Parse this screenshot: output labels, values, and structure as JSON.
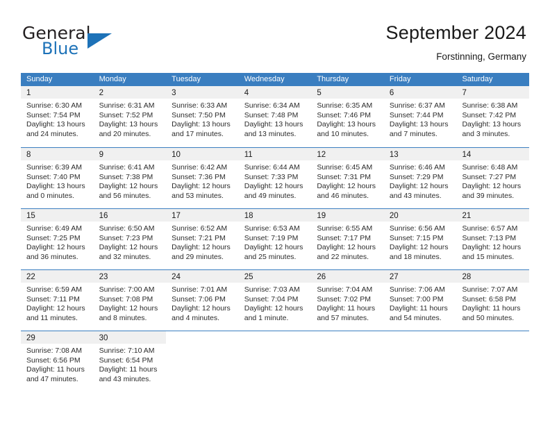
{
  "brand": {
    "name_top": "General",
    "name_bottom": "Blue",
    "accent_color": "#1d72b8"
  },
  "header": {
    "month_title": "September 2024",
    "location": "Forstinning, Germany"
  },
  "calendar": {
    "header_bg": "#3a7ec0",
    "day_strip_bg": "#f0f0f0",
    "weekdays": [
      "Sunday",
      "Monday",
      "Tuesday",
      "Wednesday",
      "Thursday",
      "Friday",
      "Saturday"
    ],
    "weeks": [
      [
        {
          "day": "1",
          "sunrise": "Sunrise: 6:30 AM",
          "sunset": "Sunset: 7:54 PM",
          "daylight1": "Daylight: 13 hours",
          "daylight2": "and 24 minutes."
        },
        {
          "day": "2",
          "sunrise": "Sunrise: 6:31 AM",
          "sunset": "Sunset: 7:52 PM",
          "daylight1": "Daylight: 13 hours",
          "daylight2": "and 20 minutes."
        },
        {
          "day": "3",
          "sunrise": "Sunrise: 6:33 AM",
          "sunset": "Sunset: 7:50 PM",
          "daylight1": "Daylight: 13 hours",
          "daylight2": "and 17 minutes."
        },
        {
          "day": "4",
          "sunrise": "Sunrise: 6:34 AM",
          "sunset": "Sunset: 7:48 PM",
          "daylight1": "Daylight: 13 hours",
          "daylight2": "and 13 minutes."
        },
        {
          "day": "5",
          "sunrise": "Sunrise: 6:35 AM",
          "sunset": "Sunset: 7:46 PM",
          "daylight1": "Daylight: 13 hours",
          "daylight2": "and 10 minutes."
        },
        {
          "day": "6",
          "sunrise": "Sunrise: 6:37 AM",
          "sunset": "Sunset: 7:44 PM",
          "daylight1": "Daylight: 13 hours",
          "daylight2": "and 7 minutes."
        },
        {
          "day": "7",
          "sunrise": "Sunrise: 6:38 AM",
          "sunset": "Sunset: 7:42 PM",
          "daylight1": "Daylight: 13 hours",
          "daylight2": "and 3 minutes."
        }
      ],
      [
        {
          "day": "8",
          "sunrise": "Sunrise: 6:39 AM",
          "sunset": "Sunset: 7:40 PM",
          "daylight1": "Daylight: 13 hours",
          "daylight2": "and 0 minutes."
        },
        {
          "day": "9",
          "sunrise": "Sunrise: 6:41 AM",
          "sunset": "Sunset: 7:38 PM",
          "daylight1": "Daylight: 12 hours",
          "daylight2": "and 56 minutes."
        },
        {
          "day": "10",
          "sunrise": "Sunrise: 6:42 AM",
          "sunset": "Sunset: 7:36 PM",
          "daylight1": "Daylight: 12 hours",
          "daylight2": "and 53 minutes."
        },
        {
          "day": "11",
          "sunrise": "Sunrise: 6:44 AM",
          "sunset": "Sunset: 7:33 PM",
          "daylight1": "Daylight: 12 hours",
          "daylight2": "and 49 minutes."
        },
        {
          "day": "12",
          "sunrise": "Sunrise: 6:45 AM",
          "sunset": "Sunset: 7:31 PM",
          "daylight1": "Daylight: 12 hours",
          "daylight2": "and 46 minutes."
        },
        {
          "day": "13",
          "sunrise": "Sunrise: 6:46 AM",
          "sunset": "Sunset: 7:29 PM",
          "daylight1": "Daylight: 12 hours",
          "daylight2": "and 43 minutes."
        },
        {
          "day": "14",
          "sunrise": "Sunrise: 6:48 AM",
          "sunset": "Sunset: 7:27 PM",
          "daylight1": "Daylight: 12 hours",
          "daylight2": "and 39 minutes."
        }
      ],
      [
        {
          "day": "15",
          "sunrise": "Sunrise: 6:49 AM",
          "sunset": "Sunset: 7:25 PM",
          "daylight1": "Daylight: 12 hours",
          "daylight2": "and 36 minutes."
        },
        {
          "day": "16",
          "sunrise": "Sunrise: 6:50 AM",
          "sunset": "Sunset: 7:23 PM",
          "daylight1": "Daylight: 12 hours",
          "daylight2": "and 32 minutes."
        },
        {
          "day": "17",
          "sunrise": "Sunrise: 6:52 AM",
          "sunset": "Sunset: 7:21 PM",
          "daylight1": "Daylight: 12 hours",
          "daylight2": "and 29 minutes."
        },
        {
          "day": "18",
          "sunrise": "Sunrise: 6:53 AM",
          "sunset": "Sunset: 7:19 PM",
          "daylight1": "Daylight: 12 hours",
          "daylight2": "and 25 minutes."
        },
        {
          "day": "19",
          "sunrise": "Sunrise: 6:55 AM",
          "sunset": "Sunset: 7:17 PM",
          "daylight1": "Daylight: 12 hours",
          "daylight2": "and 22 minutes."
        },
        {
          "day": "20",
          "sunrise": "Sunrise: 6:56 AM",
          "sunset": "Sunset: 7:15 PM",
          "daylight1": "Daylight: 12 hours",
          "daylight2": "and 18 minutes."
        },
        {
          "day": "21",
          "sunrise": "Sunrise: 6:57 AM",
          "sunset": "Sunset: 7:13 PM",
          "daylight1": "Daylight: 12 hours",
          "daylight2": "and 15 minutes."
        }
      ],
      [
        {
          "day": "22",
          "sunrise": "Sunrise: 6:59 AM",
          "sunset": "Sunset: 7:11 PM",
          "daylight1": "Daylight: 12 hours",
          "daylight2": "and 11 minutes."
        },
        {
          "day": "23",
          "sunrise": "Sunrise: 7:00 AM",
          "sunset": "Sunset: 7:08 PM",
          "daylight1": "Daylight: 12 hours",
          "daylight2": "and 8 minutes."
        },
        {
          "day": "24",
          "sunrise": "Sunrise: 7:01 AM",
          "sunset": "Sunset: 7:06 PM",
          "daylight1": "Daylight: 12 hours",
          "daylight2": "and 4 minutes."
        },
        {
          "day": "25",
          "sunrise": "Sunrise: 7:03 AM",
          "sunset": "Sunset: 7:04 PM",
          "daylight1": "Daylight: 12 hours",
          "daylight2": "and 1 minute."
        },
        {
          "day": "26",
          "sunrise": "Sunrise: 7:04 AM",
          "sunset": "Sunset: 7:02 PM",
          "daylight1": "Daylight: 11 hours",
          "daylight2": "and 57 minutes."
        },
        {
          "day": "27",
          "sunrise": "Sunrise: 7:06 AM",
          "sunset": "Sunset: 7:00 PM",
          "daylight1": "Daylight: 11 hours",
          "daylight2": "and 54 minutes."
        },
        {
          "day": "28",
          "sunrise": "Sunrise: 7:07 AM",
          "sunset": "Sunset: 6:58 PM",
          "daylight1": "Daylight: 11 hours",
          "daylight2": "and 50 minutes."
        }
      ],
      [
        {
          "day": "29",
          "sunrise": "Sunrise: 7:08 AM",
          "sunset": "Sunset: 6:56 PM",
          "daylight1": "Daylight: 11 hours",
          "daylight2": "and 47 minutes."
        },
        {
          "day": "30",
          "sunrise": "Sunrise: 7:10 AM",
          "sunset": "Sunset: 6:54 PM",
          "daylight1": "Daylight: 11 hours",
          "daylight2": "and 43 minutes."
        },
        {
          "day": "",
          "sunrise": "",
          "sunset": "",
          "daylight1": "",
          "daylight2": ""
        },
        {
          "day": "",
          "sunrise": "",
          "sunset": "",
          "daylight1": "",
          "daylight2": ""
        },
        {
          "day": "",
          "sunrise": "",
          "sunset": "",
          "daylight1": "",
          "daylight2": ""
        },
        {
          "day": "",
          "sunrise": "",
          "sunset": "",
          "daylight1": "",
          "daylight2": ""
        },
        {
          "day": "",
          "sunrise": "",
          "sunset": "",
          "daylight1": "",
          "daylight2": ""
        }
      ]
    ]
  }
}
